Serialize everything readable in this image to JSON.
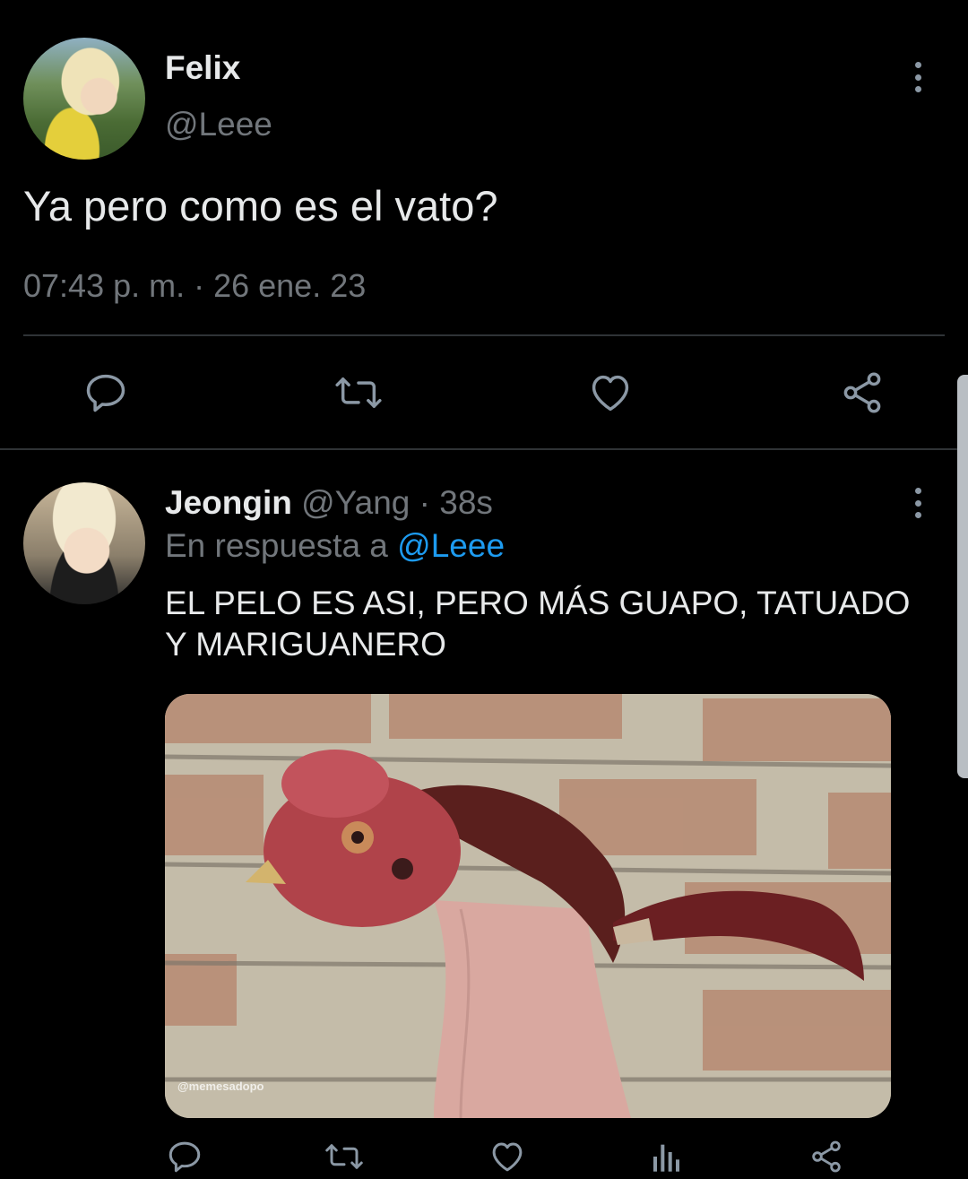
{
  "main_tweet": {
    "author_name": "Felix",
    "author_handle": "@Leee",
    "text": "Ya pero como es el vato?",
    "timestamp": "07:43 p. m. · 26 ene. 23",
    "actions": {
      "reply_icon": "comment-icon",
      "retweet_icon": "retweet-icon",
      "like_icon": "heart-icon",
      "share_icon": "share-icon"
    }
  },
  "reply": {
    "author_name": "Jeongin",
    "author_handle": "@Yang",
    "separator": "·",
    "time": "38s",
    "reply_to_label": "En respuesta a",
    "reply_to_handle": "@Leee",
    "text": "EL PELO ES ASI, PERO MÁS GUAPO, TATUADO Y MARIGUANERO",
    "media_watermark": "@memesadopo",
    "actions": {
      "reply_icon": "comment-icon",
      "retweet_icon": "retweet-icon",
      "like_icon": "heart-icon",
      "views_icon": "analytics-icon",
      "share_icon": "share-icon"
    }
  },
  "colors": {
    "background": "#000000",
    "primary_text": "#e7e9ea",
    "secondary_text": "#71767b",
    "link": "#1d9bf0",
    "divider": "#2f3336",
    "icon": "#8b98a5"
  }
}
